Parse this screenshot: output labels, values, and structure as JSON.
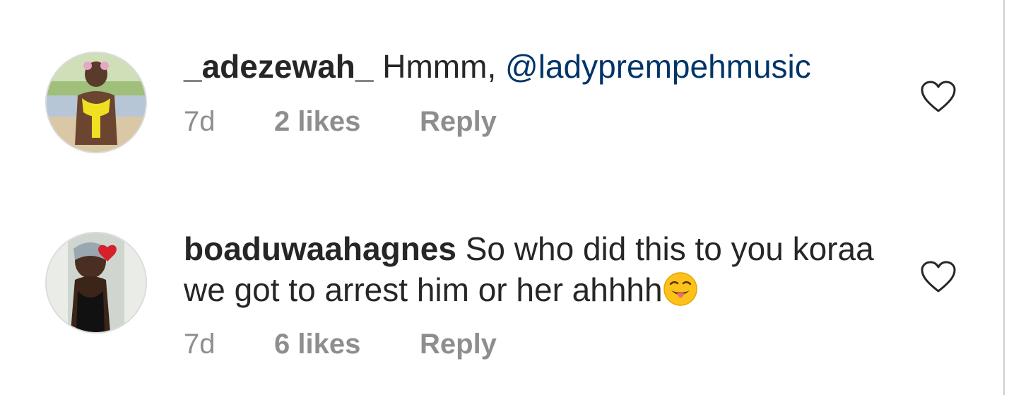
{
  "comments": [
    {
      "username": "_adezewah_",
      "text": "Hmmm,",
      "mention": "@ladyprempehmusic",
      "time": "7d",
      "likes": "2 likes",
      "reply": "Reply",
      "avatar_icon": "user-avatar",
      "heart_icon": "heart-outline-icon"
    },
    {
      "username": "boaduwaahagnes",
      "text": "So who did this to you koraa we got to arrest him or her ahhhh",
      "emoji": "😜",
      "time": "7d",
      "likes": "6 likes",
      "reply": "Reply",
      "avatar_icon": "user-avatar",
      "heart_icon": "heart-outline-icon"
    }
  ],
  "colors": {
    "text": "#262626",
    "meta": "#8e8e8e",
    "mention": "#003569",
    "heart_stroke": "#262626"
  }
}
